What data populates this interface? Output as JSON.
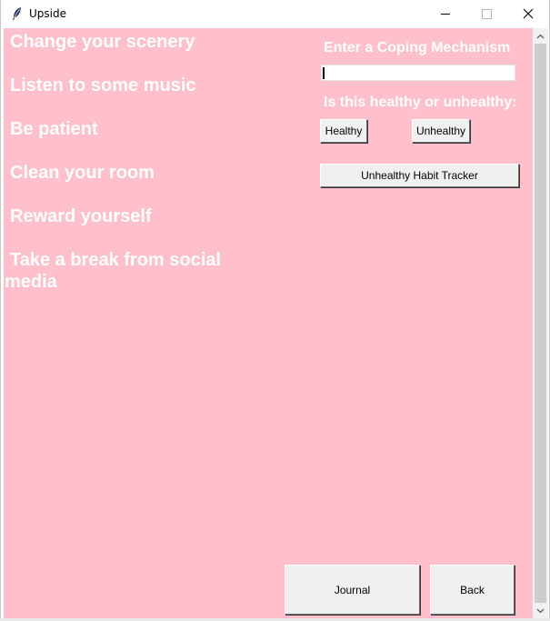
{
  "window": {
    "title": "Upside",
    "icon": "feather-icon",
    "controls": [
      "minimize",
      "maximize",
      "close"
    ]
  },
  "mechanisms": [
    "Change your scenery",
    "Listen to some music",
    "Be patient",
    "Clean your room",
    "Reward yourself",
    "Take a break from social media"
  ],
  "form": {
    "enter_label": "Enter a Coping Mechanism",
    "entry_value": "",
    "question_label": "Is this healthy or unhealthy:",
    "healthy_button": "Healthy",
    "unhealthy_button": "Unhealthy",
    "tracker_button": "Unhealthy Habit Tracker"
  },
  "footer": {
    "journal_button": "Journal",
    "back_button": "Back"
  },
  "colors": {
    "background": "#ffc0cb",
    "text": "#ffffff",
    "button_face": "#f0f0f0"
  }
}
